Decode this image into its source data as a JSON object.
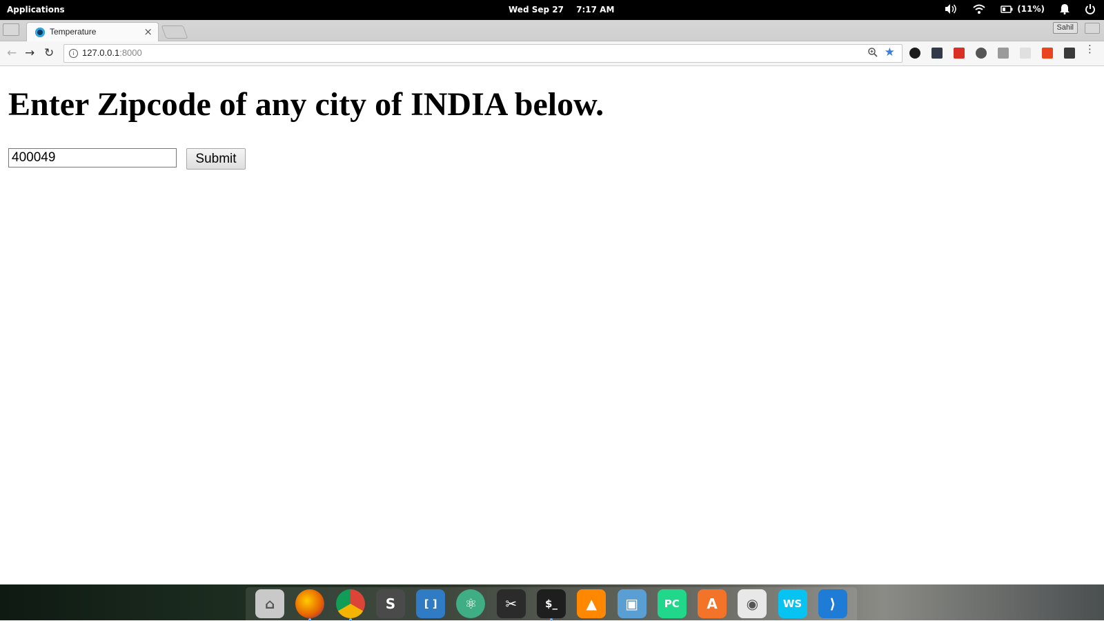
{
  "system_bar": {
    "applications_label": "Applications",
    "date": "Wed Sep 27",
    "time": "7:17 AM",
    "battery_label": "(11%)",
    "icons": [
      "volume-icon",
      "wifi-icon",
      "battery-icon",
      "bell-icon",
      "power-icon"
    ]
  },
  "browser": {
    "tab_title": "Temperature",
    "tab_close_glyph": "×",
    "profile_name": "Sahil",
    "url_host": "127.0.0.1",
    "url_port": ":8000",
    "info_glyph": "i",
    "star_glyph": "★",
    "back_glyph": "←",
    "forward_glyph": "→",
    "reload_glyph": "↻",
    "menu_glyph": "⋮",
    "extension_colors": [
      "#1b1b1b",
      "#2f3b47",
      "#d93025",
      "#555555",
      "#9a9a9a",
      "#e0e0e0",
      "#e8451e",
      "#3a3a3a"
    ]
  },
  "page": {
    "heading": "Enter Zipcode of any city of INDIA below.",
    "zip_input_value": "400049",
    "submit_label": "Submit"
  },
  "dock": {
    "apps": [
      {
        "name": "files-icon",
        "color": "#c9c9c9",
        "glyph": "⌂",
        "running": false
      },
      {
        "name": "firefox-icon",
        "color": "#e66000",
        "glyph": "",
        "running": true
      },
      {
        "name": "chrome-icon",
        "color": "#4285f4",
        "glyph": "",
        "running": true
      },
      {
        "name": "sublime-text-icon",
        "color": "#4a4a4a",
        "glyph": "S",
        "running": false
      },
      {
        "name": "brackets-icon",
        "color": "#2f7bc4",
        "glyph": "[ ]",
        "running": false
      },
      {
        "name": "atom-icon",
        "color": "#3fae84",
        "glyph": "⚛",
        "running": false
      },
      {
        "name": "screenshot-icon",
        "color": "#2b2b2b",
        "glyph": "✂",
        "running": false
      },
      {
        "name": "terminal-icon",
        "color": "#1e1e1e",
        "glyph": "$_",
        "running": true
      },
      {
        "name": "vlc-icon",
        "color": "#ff8800",
        "glyph": "▲",
        "running": false
      },
      {
        "name": "image-viewer-icon",
        "color": "#5a9fd4",
        "glyph": "▣",
        "running": false
      },
      {
        "name": "pycharm-icon",
        "color": "#21d789",
        "glyph": "PC",
        "running": false
      },
      {
        "name": "app-center-icon",
        "color": "#f37329",
        "glyph": "A",
        "running": false
      },
      {
        "name": "settings-toggle-icon",
        "color": "#e8e8e8",
        "glyph": "◉",
        "running": false
      },
      {
        "name": "webstorm-icon",
        "color": "#07c3f2",
        "glyph": "WS",
        "running": false
      },
      {
        "name": "vscode-icon",
        "color": "#1e7bd6",
        "glyph": "⟩",
        "running": false
      }
    ]
  }
}
